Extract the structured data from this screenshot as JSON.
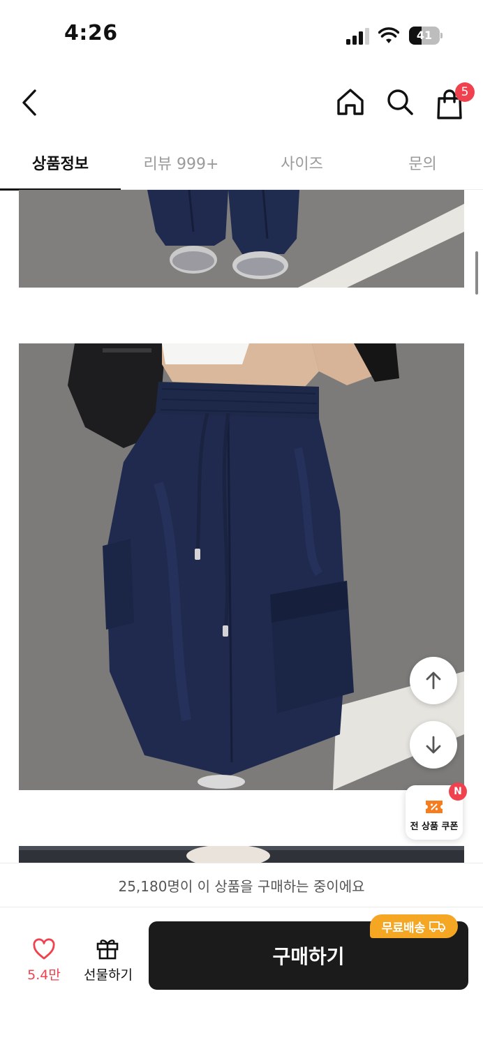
{
  "status_bar": {
    "time": "4:26",
    "battery": "41"
  },
  "header": {
    "back_icon": "chevron-left-icon",
    "home_icon": "home-icon",
    "search_icon": "search-icon",
    "cart_icon": "shopping-bag-icon",
    "cart_count": "5"
  },
  "tabs": [
    {
      "label": "상품정보",
      "active": true
    },
    {
      "label": "리뷰 999+",
      "active": false
    },
    {
      "label": "사이즈",
      "active": false
    },
    {
      "label": "문의",
      "active": false
    }
  ],
  "floating": {
    "scroll_up_icon": "arrow-up-icon",
    "scroll_down_icon": "arrow-down-icon",
    "coupon_label": "전 상품 쿠폰",
    "coupon_badge": "N"
  },
  "banner": {
    "text": "25,180명이 이 상품을 구매하는 중이에요"
  },
  "bottom_bar": {
    "like_count": "5.4만",
    "gift_label": "선물하기",
    "buy_label": "구매하기",
    "free_shipping_label": "무료배송"
  },
  "colors": {
    "accent_red": "#f0414f",
    "badge_orange": "#f5a623",
    "buy_button": "#1b1b1b",
    "pants_navy": "#1f2a4e"
  }
}
